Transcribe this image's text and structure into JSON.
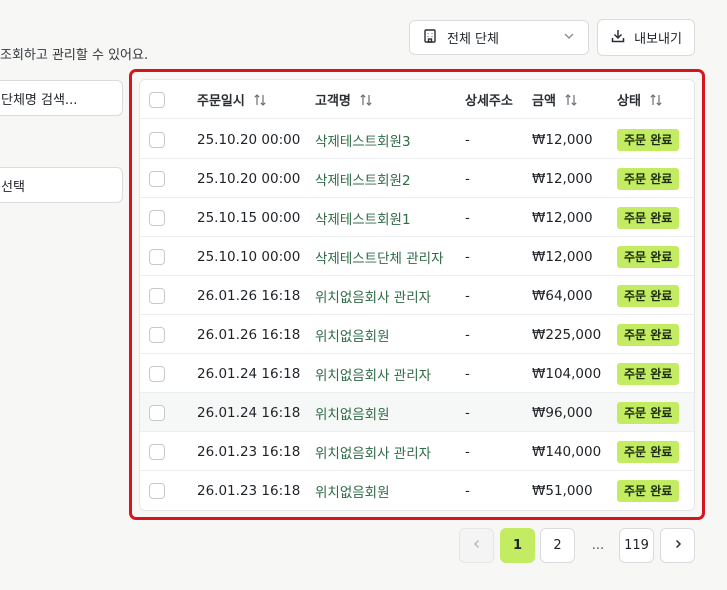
{
  "subtitle": "조회하고 관리할 수 있어요.",
  "filters": {
    "group_search_placeholder": "단체명 검색...",
    "select_label": "선택"
  },
  "toolbar": {
    "group_select_value": "전체 단체",
    "export_label": "내보내기"
  },
  "table": {
    "columns": {
      "date": "주문일시",
      "customer": "고객명",
      "address": "상세주소",
      "amount": "금액",
      "status": "상태"
    },
    "rows": [
      {
        "date": "25.10.20 00:00",
        "customer": "삭제테스트회원3",
        "address": "-",
        "amount": "₩12,000",
        "status": "주문 완료"
      },
      {
        "date": "25.10.20 00:00",
        "customer": "삭제테스트회원2",
        "address": "-",
        "amount": "₩12,000",
        "status": "주문 완료"
      },
      {
        "date": "25.10.15 00:00",
        "customer": "삭제테스트회원1",
        "address": "-",
        "amount": "₩12,000",
        "status": "주문 완료"
      },
      {
        "date": "25.10.10 00:00",
        "customer": "삭제테스트단체 관리자",
        "address": "-",
        "amount": "₩12,000",
        "status": "주문 완료"
      },
      {
        "date": "26.01.26 16:18",
        "customer": "위치없음회사 관리자",
        "address": "-",
        "amount": "₩64,000",
        "status": "주문 완료"
      },
      {
        "date": "26.01.26 16:18",
        "customer": "위치없음회원",
        "address": "-",
        "amount": "₩225,000",
        "status": "주문 완료"
      },
      {
        "date": "26.01.24 16:18",
        "customer": "위치없음회사 관리자",
        "address": "-",
        "amount": "₩104,000",
        "status": "주문 완료"
      },
      {
        "date": "26.01.24 16:18",
        "customer": "위치없음회원",
        "address": "-",
        "amount": "₩96,000",
        "status": "주문 완료"
      },
      {
        "date": "26.01.23 16:18",
        "customer": "위치없음회사 관리자",
        "address": "-",
        "amount": "₩140,000",
        "status": "주문 완료"
      },
      {
        "date": "26.01.23 16:18",
        "customer": "위치없음회원",
        "address": "-",
        "amount": "₩51,000",
        "status": "주문 완료"
      }
    ]
  },
  "pagination": {
    "pages": [
      "1",
      "2"
    ],
    "current": "1",
    "ellipsis": "...",
    "last": "119"
  },
  "colors": {
    "accent": "#c4ec63",
    "link": "#2f6b47",
    "highlight": "#d6151d"
  },
  "icons": {
    "building": "building-icon",
    "chevron": "chevron-down-icon",
    "download": "download-icon",
    "sort": "sort-arrows-icon",
    "prev": "chevron-left-icon",
    "next": "chevron-right-icon"
  }
}
